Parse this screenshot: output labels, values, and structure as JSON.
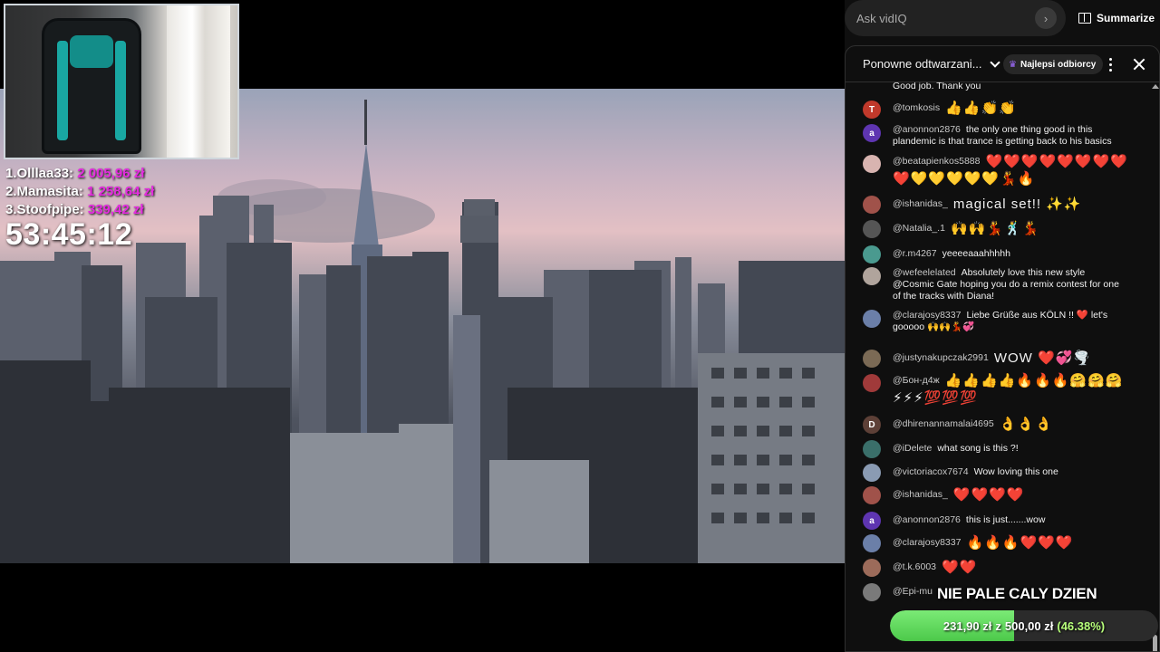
{
  "overlay": {
    "leaderboard": [
      {
        "rank_name": "1.Olllaa33:",
        "amount": "2 005,96 zł"
      },
      {
        "rank_name": "2.Mamasita:",
        "amount": "1 258,64 zł"
      },
      {
        "rank_name": "3.Stoofpipe:",
        "amount": "339,42 zł"
      }
    ],
    "timer": "53:45:12",
    "goal": {
      "title": "NIE PALE CALY DZIEN",
      "current": "231,90 zł",
      "separator": "z",
      "target": "500,00 zł",
      "percent_label": "(46.38%)",
      "progress": 0.4638,
      "fill_color": "#4cc94a"
    }
  },
  "vidiq": {
    "placeholder": "Ask vidIQ",
    "go_icon": "chevron-right-icon",
    "summarize_label": "Summarize",
    "summarize_icon": "book-icon"
  },
  "chat": {
    "mode_label": "Ponowne odtwarzani...",
    "top_fans_label": "Najlepsi odbiorcy",
    "top_fans_icon": "crown-icon",
    "messages": [
      {
        "author": "",
        "text": "Good job. Thank you",
        "avatar_letter": "",
        "avatar_color": ""
      },
      {
        "author": "@tomkosis",
        "text": "👍👍👏👏",
        "avatar_letter": "T",
        "avatar_color": "#c0392b"
      },
      {
        "author": "@anonnon2876",
        "text": "the only one thing good in this plandemic is that trance is getting back to his basics",
        "avatar_letter": "a",
        "avatar_color": "#5e35b1"
      },
      {
        "author": "@beatapienkos5888",
        "text": "❤️❤️❤️❤️❤️❤️❤️❤️❤️💛💛💛💛💛💃🔥",
        "avatar_letter": "",
        "avatar_color": "#d8b4b0"
      },
      {
        "author": "@ishanidas_",
        "text": "magical set!! ✨✨",
        "avatar_letter": "",
        "avatar_color": "#a0524a"
      },
      {
        "author": "@Natalia_.1",
        "text": "🙌🙌💃🕺💃",
        "avatar_letter": "",
        "avatar_color": "#555555"
      },
      {
        "author": "@r.m4267",
        "text": "yeeeeaaahhhhh",
        "avatar_letter": "",
        "avatar_color": "#4a9a8f"
      },
      {
        "author": "@wefeelelated",
        "text": "Absolutely love this new style @Cosmic Gate hoping you do a remix contest for one of the tracks with Diana!",
        "avatar_letter": "",
        "avatar_color": "#b0a49c"
      },
      {
        "author": "@clarajosy8337",
        "text": "Liebe Grüße aus KÖLN !! ❤️ let's gooooo 🙌🙌💃💞",
        "avatar_letter": "",
        "avatar_color": "#6b7fa8"
      },
      {
        "author": "@justynakupczak2991",
        "text": "WOW ❤️💞🌪️",
        "avatar_letter": "",
        "avatar_color": "#7b6a55"
      },
      {
        "author": "@Бон-д4ж",
        "text": "👍👍👍👍🔥🔥🔥🤗🤗🤗⚡⚡⚡💯💯💯",
        "avatar_letter": "",
        "avatar_color": "#a03a3a"
      },
      {
        "author": "@dhirenannamalai4695",
        "text": "👌👌👌",
        "avatar_letter": "D",
        "avatar_color": "#5d4037"
      },
      {
        "author": "@iDelete",
        "text": "what song is this ?!",
        "avatar_letter": "",
        "avatar_color": "#3a6f6a"
      },
      {
        "author": "@victoriacox7674",
        "text": "Wow loving this one",
        "avatar_letter": "",
        "avatar_color": "#8a9bb3"
      },
      {
        "author": "@ishanidas_",
        "text": "❤️❤️❤️❤️",
        "avatar_letter": "",
        "avatar_color": "#a0524a"
      },
      {
        "author": "@anonnon2876",
        "text": "this is just.......wow",
        "avatar_letter": "a",
        "avatar_color": "#5e35b1"
      },
      {
        "author": "@clarajosy8337",
        "text": "🔥🔥🔥❤️❤️❤️",
        "avatar_letter": "",
        "avatar_color": "#6b7fa8"
      },
      {
        "author": "@t.k.6003",
        "text": "❤️❤️",
        "avatar_letter": "",
        "avatar_color": "#9c6b5a"
      },
      {
        "author": "@Epi-mu",
        "text": "",
        "avatar_letter": "",
        "avatar_color": "#7a7a7a"
      }
    ]
  }
}
